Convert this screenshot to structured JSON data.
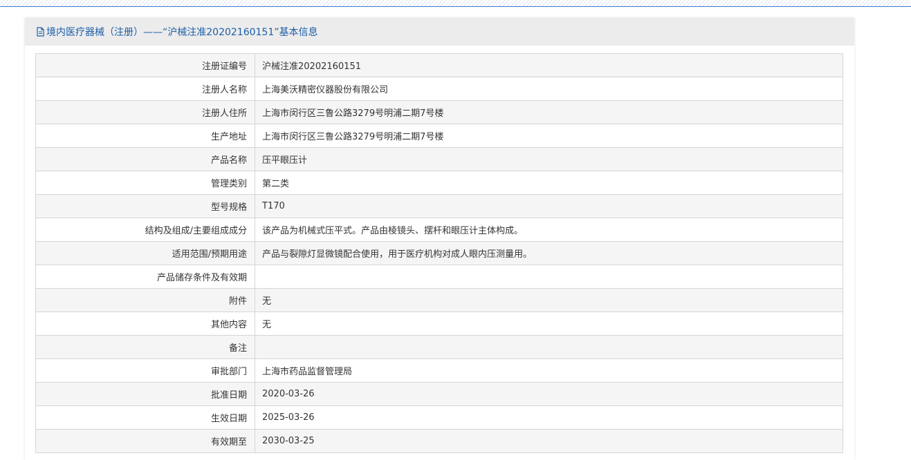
{
  "header": {
    "title": "境内医疗器械（注册）——“沪械注准20202160151”基本信息",
    "icon": "document-icon"
  },
  "rows": [
    {
      "label": "注册证编号",
      "value": "沪械注准20202160151"
    },
    {
      "label": "注册人名称",
      "value": "上海美沃精密仪器股份有限公司"
    },
    {
      "label": "注册人住所",
      "value": "上海市闵行区三鲁公路3279号明浦二期7号楼"
    },
    {
      "label": "生产地址",
      "value": "上海市闵行区三鲁公路3279号明浦二期7号楼"
    },
    {
      "label": "产品名称",
      "value": "压平眼压计"
    },
    {
      "label": "管理类别",
      "value": "第二类"
    },
    {
      "label": "型号规格",
      "value": "T170"
    },
    {
      "label": "结构及组成/主要组成成分",
      "value": "该产品为机械式压平式。产品由棱镜头、摆杆和眼压计主体构成。"
    },
    {
      "label": "适用范围/预期用途",
      "value": "产品与裂隙灯显微镜配合使用，用于医疗机构对成人眼内压测量用。"
    },
    {
      "label": "产品储存条件及有效期",
      "value": ""
    },
    {
      "label": "附件",
      "value": "无"
    },
    {
      "label": "其他内容",
      "value": "无"
    },
    {
      "label": "备注",
      "value": ""
    },
    {
      "label": "审批部门",
      "value": "上海市药品监督管理局"
    },
    {
      "label": "批准日期",
      "value": "2020-03-26"
    },
    {
      "label": "生效日期",
      "value": "2025-03-26"
    },
    {
      "label": "有效期至",
      "value": "2030-03-25"
    }
  ],
  "colors": {
    "header_text": "#1c5ea8",
    "header_bg": "#ececec",
    "row_alt_bg": "#f5f5f5",
    "border": "#d5d5d5",
    "top_rule": "#3a78c9"
  }
}
